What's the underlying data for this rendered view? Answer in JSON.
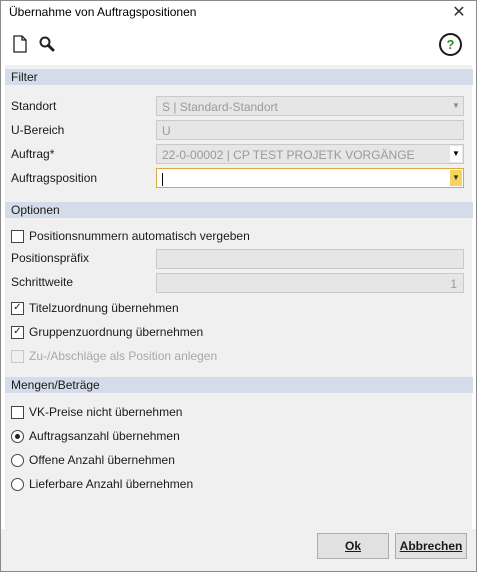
{
  "window": {
    "title": "Übernahme von Auftragspositionen",
    "close_label": "✕"
  },
  "toolbar": {
    "new_icon": "document-icon",
    "search_icon": "search-icon",
    "help_label": "?"
  },
  "filter": {
    "section_label": "Filter",
    "standort_label": "Standort",
    "standort_value": "S | Standard-Standort",
    "ubereich_label": "U-Bereich",
    "ubereich_value": "U",
    "auftrag_label": "Auftrag*",
    "auftrag_value": "22-0-00002 | CP TEST PROJETK VORGÄNGE",
    "auftragsposition_label": "Auftragsposition",
    "auftragsposition_value": ""
  },
  "optionen": {
    "section_label": "Optionen",
    "auto_numbers_label": "Positionsnummern automatisch vergeben",
    "auto_numbers_checked": false,
    "prefix_label": "Positionspräfix",
    "prefix_value": "",
    "step_label": "Schrittweite",
    "step_value": "1",
    "title_assign_label": "Titelzuordnung übernehmen",
    "title_assign_checked": true,
    "group_assign_label": "Gruppenzuordnung übernehmen",
    "group_assign_checked": true,
    "surcharge_label": "Zu-/Abschläge als Position anlegen",
    "surcharge_checked": false
  },
  "mengen": {
    "section_label": "Mengen/Beträge",
    "vk_prices_label": "VK-Preise nicht übernehmen",
    "vk_prices_checked": false,
    "radio_options": [
      {
        "label": "Auftragsanzahl übernehmen",
        "selected": true
      },
      {
        "label": "Offene Anzahl übernehmen",
        "selected": false
      },
      {
        "label": "Lieferbare Anzahl übernehmen",
        "selected": false
      }
    ]
  },
  "footer": {
    "ok_label": "Ok",
    "cancel_label": "Abbrechen"
  },
  "colors": {
    "section_bg": "#d4dce9",
    "active_border": "#d9a93b",
    "dropdown_accent": "#f4d35e",
    "help_green": "#2e8b2e"
  }
}
